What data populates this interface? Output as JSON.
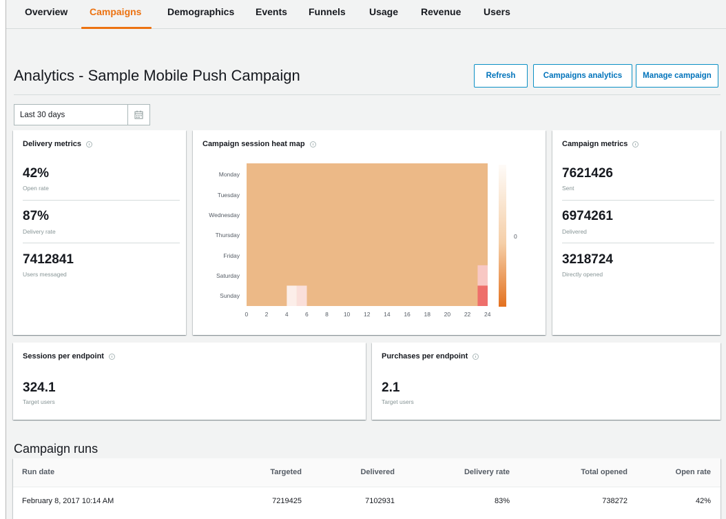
{
  "nav": {
    "tabs": [
      {
        "label": "Overview",
        "active": false
      },
      {
        "label": "Campaigns",
        "active": true
      },
      {
        "label": "Demographics",
        "active": false
      },
      {
        "label": "Events",
        "active": false
      },
      {
        "label": "Funnels",
        "active": false
      },
      {
        "label": "Usage",
        "active": false
      },
      {
        "label": "Revenue",
        "active": false
      },
      {
        "label": "Users",
        "active": false
      }
    ]
  },
  "header": {
    "title": "Analytics - Sample Mobile Push Campaign",
    "buttons": {
      "refresh": "Refresh",
      "campaigns_analytics": "Campaigns analytics",
      "manage_campaign": "Manage campaign"
    }
  },
  "date_range": {
    "value": "Last 30 days",
    "icon": "calendar-icon"
  },
  "delivery_metrics": {
    "title": "Delivery metrics",
    "items": [
      {
        "value": "42%",
        "label": "Open rate"
      },
      {
        "value": "87%",
        "label": "Delivery rate"
      },
      {
        "value": "7412841",
        "label": "Users messaged"
      }
    ]
  },
  "heatmap": {
    "title": "Campaign session heat map",
    "scale_label": "0"
  },
  "campaign_metrics": {
    "title": "Campaign metrics",
    "items": [
      {
        "value": "7621426",
        "label": "Sent"
      },
      {
        "value": "6974261",
        "label": "Delivered"
      },
      {
        "value": "3218724",
        "label": "Directly opened"
      }
    ]
  },
  "sessions_per_endpoint": {
    "title": "Sessions per endpoint",
    "value": "324.1",
    "label": "Target users"
  },
  "purchases_per_endpoint": {
    "title": "Purchases per endpoint",
    "value": "2.1",
    "label": "Target users"
  },
  "campaign_runs": {
    "title": "Campaign runs",
    "columns": [
      "Run date",
      "Targeted",
      "Delivered",
      "Delivery rate",
      "Total opened",
      "Open rate"
    ],
    "rows": [
      [
        "February 8, 2017 10:14 AM",
        "7219425",
        "7102931",
        "83%",
        "738272",
        "42%"
      ]
    ]
  },
  "colors": {
    "accent": "#ec7211",
    "link": "#0073bb",
    "heat_base": "#ecb987"
  },
  "chart_data": {
    "type": "heatmap",
    "title": "Campaign session heat map",
    "y_categories": [
      "Monday",
      "Tuesday",
      "Wednesday",
      "Thursday",
      "Friday",
      "Saturday",
      "Sunday"
    ],
    "x_ticks": [
      0,
      2,
      4,
      6,
      8,
      10,
      12,
      14,
      16,
      18,
      20,
      22,
      24
    ],
    "xlim": [
      0,
      24
    ],
    "colorbar": {
      "ticks": [
        0
      ]
    },
    "highlighted_cells": [
      {
        "day": "Sunday",
        "hour": 4,
        "level": 0.05
      },
      {
        "day": "Sunday",
        "hour": 5,
        "level": 0.15
      },
      {
        "day": "Saturday",
        "hour": 23,
        "level": 0.3
      },
      {
        "day": "Sunday",
        "hour": 23,
        "level": 0.9
      }
    ]
  }
}
